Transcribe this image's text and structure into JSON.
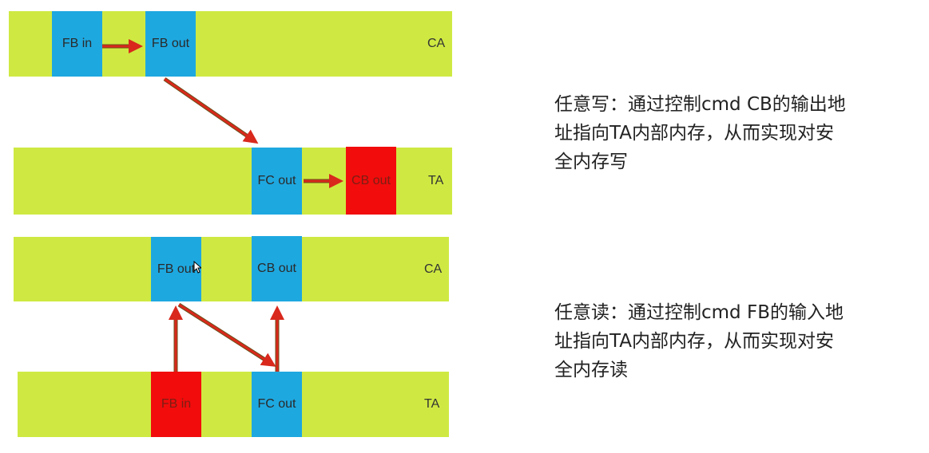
{
  "diagram_write": {
    "ca_row": {
      "label": "CA",
      "box1": "FB in",
      "box2": "FB out"
    },
    "ta_row": {
      "label": "TA",
      "box1": "FC out",
      "box2": "CB out"
    }
  },
  "diagram_read": {
    "ca_row": {
      "label": "CA",
      "box1": "FB out",
      "box2": "CB out"
    },
    "ta_row": {
      "label": "TA",
      "box1": "FB in",
      "box2": "FC out"
    }
  },
  "text": {
    "write_desc": "任意写：通过控制cmd CB的输出地\n址指向TA内部内存，从而实现对安\n全内存写",
    "read_desc": "任意读：通过控制cmd FB的输入地\n址指向TA内部内存，从而实现对安\n全内存读"
  },
  "colors": {
    "bar": "#cfe942",
    "blue_box": "#1ea8e0",
    "red_box": "#f20c0c",
    "arrow": "#d9281c"
  }
}
